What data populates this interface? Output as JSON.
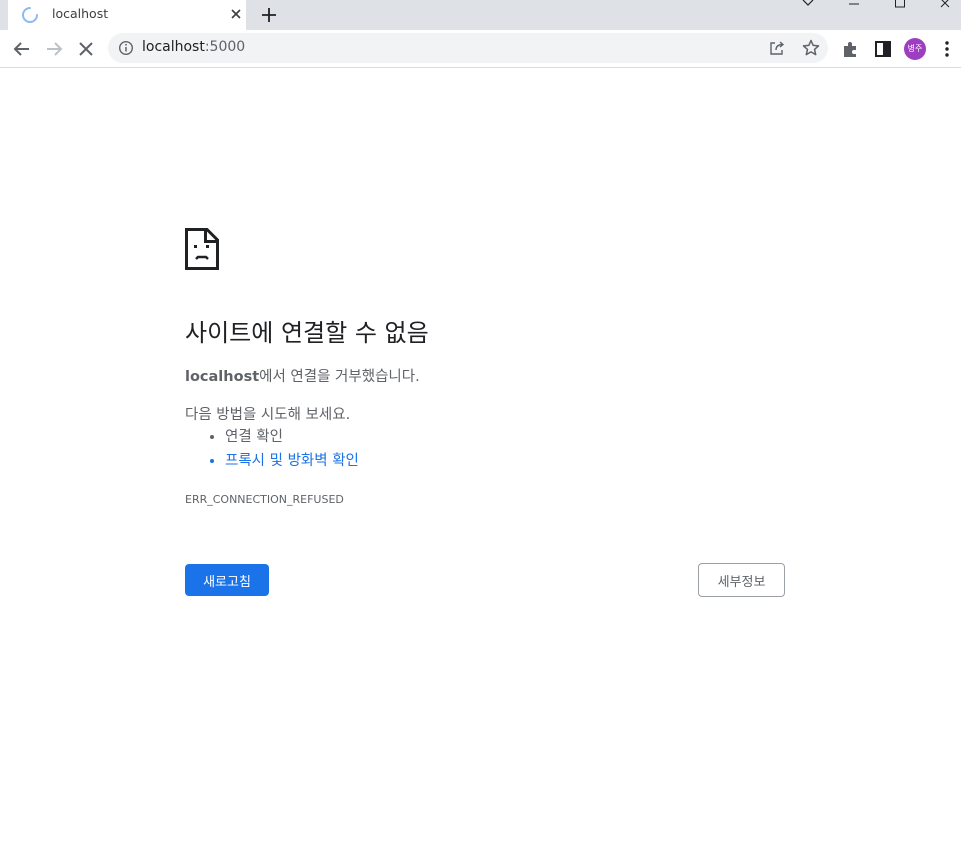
{
  "browser": {
    "tab": {
      "title": "localhost",
      "close_icon": "close-icon",
      "loading_icon": "spinner-icon"
    },
    "new_tab_icon": "plus-icon",
    "window_controls": [
      "tab-search-icon",
      "minimize-icon",
      "maximize-icon",
      "close-icon"
    ],
    "address_bar": {
      "host": "localhost",
      "port": ":5000"
    },
    "profile": {
      "initials": "병주",
      "color": "#9c3ebd"
    }
  },
  "error": {
    "heading": "사이트에 연결할 수 없음",
    "host_bold": "localhost",
    "description_suffix": "에서 연결을 거부했습니다.",
    "suggestion_heading": "다음 방법을 시도해 보세요.",
    "suggestions": [
      {
        "text": "연결 확인",
        "link": false
      },
      {
        "text": "프록시 및 방화벽 확인",
        "link": true
      }
    ],
    "code": "ERR_CONNECTION_REFUSED",
    "reload_button": "새로고침",
    "details_button": "세부정보"
  },
  "colors": {
    "accent": "#1a73e8",
    "link": "#1a73e8",
    "tabstrip": "#dee1e6"
  }
}
